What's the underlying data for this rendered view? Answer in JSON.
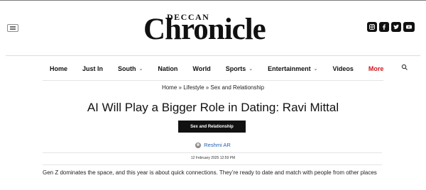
{
  "header": {
    "logo_top": "DECCAN",
    "logo_main": "Chronicle",
    "social_icons": [
      "instagram-icon",
      "facebook-icon",
      "twitter-icon",
      "youtube-icon"
    ]
  },
  "nav": {
    "items": [
      {
        "label": "Home",
        "dropdown": false
      },
      {
        "label": "Just In",
        "dropdown": false
      },
      {
        "label": "South",
        "dropdown": true
      },
      {
        "label": "Nation",
        "dropdown": false
      },
      {
        "label": "World",
        "dropdown": false
      },
      {
        "label": "Sports",
        "dropdown": true
      },
      {
        "label": "Entertainment",
        "dropdown": true
      },
      {
        "label": "Videos",
        "dropdown": false
      },
      {
        "label": "More",
        "dropdown": false
      }
    ],
    "more_color": "#d0161a"
  },
  "breadcrumb": "Home » Lifestyle » Sex and Relationship",
  "article": {
    "title": "AI Will Play a Bigger Role in Dating: Ravi Mittal",
    "tag": "Sex and Relationship",
    "author": "Reshmi AR",
    "date": "12 February 2025 12:59 PM",
    "summary": "Gen Z dominates the space, and this year is about quick connections. They’re ready to date and match with people from other places"
  },
  "colors": {
    "accent_link": "#2463b5",
    "tag_bg": "#111111"
  }
}
